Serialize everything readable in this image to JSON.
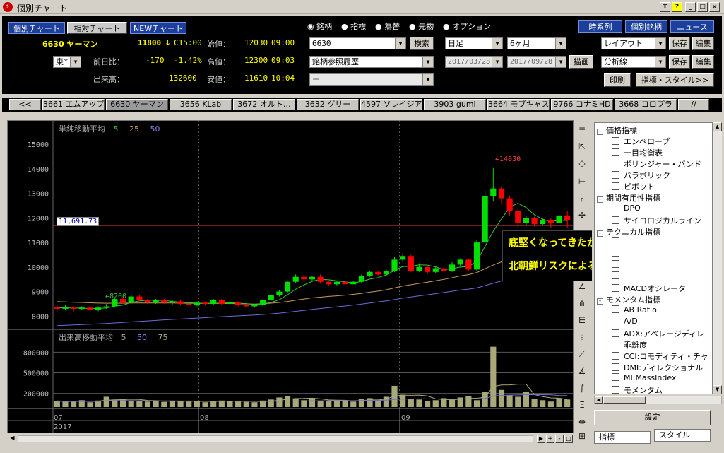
{
  "window": {
    "title": "個別チャート",
    "buttons": [
      "T",
      "?",
      "_",
      "□",
      "×"
    ]
  },
  "view_tabs": [
    "個別チャート",
    "相対チャート",
    "NEWチャート"
  ],
  "right_nav": [
    "時系列",
    "個別銘柄",
    "ニュース"
  ],
  "quote": {
    "code_name": "6630 ヤーマン",
    "price": "11800",
    "arrow": "↓",
    "time": "C15:00",
    "exchange": "東*",
    "change_label": "前日比：",
    "change": "-170",
    "change_pct": "-1.42%",
    "volume_label": "出来高：",
    "volume": "132600",
    "open_label": "始値：",
    "open": "12030",
    "open_time": "09:00",
    "high_label": "高値：",
    "high": "12300",
    "high_time": "09:03",
    "low_label": "安値：",
    "low": "11610",
    "low_time": "10:04"
  },
  "radios": {
    "items": [
      "銘柄",
      "指標",
      "為替",
      "先物",
      "オプション"
    ],
    "selected": "銘柄"
  },
  "symbol_input": "6630",
  "search_button": "検索",
  "history_select": "銘柄参照履歴",
  "blank_select": "ー",
  "period": {
    "interval": "日足",
    "span": "6ヶ月",
    "from": "2017/03/28",
    "to": "2017/09/28",
    "draw_button": "描画"
  },
  "layout": {
    "layout_label": "レイアウト",
    "analysis_label": "分析線",
    "save": "保存",
    "edit": "編集",
    "print": "印刷",
    "style_button": "指標・スタイル>>"
  },
  "stock_tabs": {
    "prev": "<<",
    "items": [
      "3661 エムアップ",
      "6630 ヤーマン",
      "3656 KLab",
      "3672 オルト…",
      "3632 グリー",
      "4597 ソレイジア",
      "3903 gumi",
      "3664 モブキャス",
      "9766 コナミHD",
      "3668 コロプラ"
    ],
    "active": "6630 ヤーマン",
    "next": "//"
  },
  "main_legend": {
    "title": "単純移動平均",
    "periods": [
      "5",
      "25",
      "50"
    ]
  },
  "vol_legend": {
    "title": "出来高移動平均",
    "periods": [
      "5",
      "50",
      "75"
    ]
  },
  "cursor_price": "11,691.73",
  "hi_label": "←14030",
  "lo_label": "←8200",
  "x_months": [
    "07",
    "08",
    "09"
  ],
  "x_year": "2017",
  "callout": {
    "line1": "底堅くなってきたか？",
    "line2": "北朝鮮リスクによる底抜けだけ危惧"
  },
  "tree": [
    {
      "type": "group",
      "label": "価格指標"
    },
    {
      "type": "item",
      "label": "エンベローブ"
    },
    {
      "type": "item",
      "label": "一目均衡表"
    },
    {
      "type": "item",
      "label": "ボリンジャー・バンド"
    },
    {
      "type": "item",
      "label": "パラボリック"
    },
    {
      "type": "item",
      "label": "ピボット"
    },
    {
      "type": "group",
      "label": "期間有用性指標"
    },
    {
      "type": "item",
      "label": "DPO"
    },
    {
      "type": "item",
      "label": "サイコロジカルライン"
    },
    {
      "type": "group",
      "label": "テクニカル指標"
    },
    {
      "type": "item",
      "label": ""
    },
    {
      "type": "item",
      "label": ""
    },
    {
      "type": "item",
      "label": ""
    },
    {
      "type": "item",
      "label": ""
    },
    {
      "type": "item",
      "label": "MACDオシレータ"
    },
    {
      "type": "group",
      "label": "モメンタム指標"
    },
    {
      "type": "item",
      "label": "AB Ratio"
    },
    {
      "type": "item",
      "label": "A/D"
    },
    {
      "type": "item",
      "label": "ADX:アベレージディレ"
    },
    {
      "type": "item",
      "label": "乖離度"
    },
    {
      "type": "item",
      "label": "CCI:コモディティ・チャ"
    },
    {
      "type": "item",
      "label": "DMI:ディレクショナル"
    },
    {
      "type": "item",
      "label": "MI:MassIndex"
    },
    {
      "type": "item",
      "label": "モメンタム"
    }
  ],
  "settings_button": "設定",
  "bottom_tabs": [
    "指標",
    "スタイル"
  ],
  "colors": {
    "up": "#00e000",
    "down": "#ff0000",
    "ma5": "#3cc43c",
    "ma25": "#c89a5a",
    "ma50": "#6a6ad8",
    "volume_bar": "#a8a878",
    "callout_text": "#ffff00"
  },
  "chart_data": {
    "type": "candlestick",
    "yticks": [
      8000,
      9000,
      10000,
      11000,
      12000,
      13000,
      14000,
      15000
    ],
    "vol_yticks": [
      200000,
      500000,
      800000
    ],
    "candles": [
      {
        "o": 8350,
        "c": 8300,
        "h": 8450,
        "l": 8200
      },
      {
        "o": 8300,
        "c": 8350,
        "h": 8450,
        "l": 8250
      },
      {
        "o": 8350,
        "c": 8300,
        "h": 8400,
        "l": 8200
      },
      {
        "o": 8300,
        "c": 8350,
        "h": 8400,
        "l": 8250
      },
      {
        "o": 8350,
        "c": 8250,
        "h": 8450,
        "l": 8200
      },
      {
        "o": 8250,
        "c": 8350,
        "h": 8400,
        "l": 8200
      },
      {
        "o": 8350,
        "c": 8400,
        "h": 8500,
        "l": 8300
      },
      {
        "o": 8400,
        "c": 8700,
        "h": 8750,
        "l": 8350
      },
      {
        "o": 8700,
        "c": 8550,
        "h": 8800,
        "l": 8500
      },
      {
        "o": 8550,
        "c": 8800,
        "h": 8900,
        "l": 8500
      },
      {
        "o": 8800,
        "c": 8650,
        "h": 8850,
        "l": 8600
      },
      {
        "o": 8650,
        "c": 8550,
        "h": 8700,
        "l": 8500
      },
      {
        "o": 8550,
        "c": 8650,
        "h": 8700,
        "l": 8500
      },
      {
        "o": 8650,
        "c": 8550,
        "h": 8700,
        "l": 8500
      },
      {
        "o": 8550,
        "c": 8600,
        "h": 8650,
        "l": 8450
      },
      {
        "o": 8600,
        "c": 8500,
        "h": 8650,
        "l": 8450
      },
      {
        "o": 8500,
        "c": 8450,
        "h": 8550,
        "l": 8400
      },
      {
        "o": 8450,
        "c": 8550,
        "h": 8600,
        "l": 8400
      },
      {
        "o": 8550,
        "c": 8500,
        "h": 8600,
        "l": 8450
      },
      {
        "o": 8500,
        "c": 8650,
        "h": 8700,
        "l": 8450
      },
      {
        "o": 8650,
        "c": 8500,
        "h": 8700,
        "l": 8450
      },
      {
        "o": 8500,
        "c": 8550,
        "h": 8600,
        "l": 8450
      },
      {
        "o": 8550,
        "c": 8450,
        "h": 8600,
        "l": 8400
      },
      {
        "o": 8450,
        "c": 8400,
        "h": 8500,
        "l": 8350
      },
      {
        "o": 8400,
        "c": 8450,
        "h": 8500,
        "l": 8350
      },
      {
        "o": 8450,
        "c": 8650,
        "h": 8700,
        "l": 8400
      },
      {
        "o": 8650,
        "c": 8850,
        "h": 8900,
        "l": 8600
      },
      {
        "o": 8850,
        "c": 9000,
        "h": 9050,
        "l": 8800
      },
      {
        "o": 9000,
        "c": 9400,
        "h": 9450,
        "l": 8950
      },
      {
        "o": 9400,
        "c": 9600,
        "h": 9700,
        "l": 9350
      },
      {
        "o": 9600,
        "c": 9500,
        "h": 9700,
        "l": 9400
      },
      {
        "o": 9500,
        "c": 9600,
        "h": 9650,
        "l": 9450
      },
      {
        "o": 9600,
        "c": 9400,
        "h": 9700,
        "l": 9350
      },
      {
        "o": 9400,
        "c": 9300,
        "h": 9450,
        "l": 9250
      },
      {
        "o": 9300,
        "c": 9400,
        "h": 9450,
        "l": 9250
      },
      {
        "o": 9400,
        "c": 9300,
        "h": 9450,
        "l": 9250
      },
      {
        "o": 9300,
        "c": 9400,
        "h": 9450,
        "l": 9300
      },
      {
        "o": 9400,
        "c": 9650,
        "h": 9700,
        "l": 9350
      },
      {
        "o": 9650,
        "c": 9800,
        "h": 9850,
        "l": 9600
      },
      {
        "o": 9800,
        "c": 9700,
        "h": 9850,
        "l": 9650
      },
      {
        "o": 9700,
        "c": 9850,
        "h": 9900,
        "l": 9650
      },
      {
        "o": 9850,
        "c": 10300,
        "h": 10400,
        "l": 9800
      },
      {
        "o": 10300,
        "c": 10450,
        "h": 10550,
        "l": 10200
      },
      {
        "o": 10450,
        "c": 9850,
        "h": 10500,
        "l": 9800
      },
      {
        "o": 9850,
        "c": 10000,
        "h": 10150,
        "l": 9800
      },
      {
        "o": 10000,
        "c": 9800,
        "h": 10050,
        "l": 9700
      },
      {
        "o": 9800,
        "c": 9950,
        "h": 10000,
        "l": 9750
      },
      {
        "o": 9950,
        "c": 9850,
        "h": 10000,
        "l": 9750
      },
      {
        "o": 9850,
        "c": 10100,
        "h": 10200,
        "l": 9800
      },
      {
        "o": 10100,
        "c": 10300,
        "h": 10350,
        "l": 10050
      },
      {
        "o": 10300,
        "c": 9900,
        "h": 10350,
        "l": 9850
      },
      {
        "o": 9900,
        "c": 11000,
        "h": 11100,
        "l": 9850
      },
      {
        "o": 11000,
        "c": 12900,
        "h": 13100,
        "l": 11000
      },
      {
        "o": 12900,
        "c": 13200,
        "h": 14030,
        "l": 12700
      },
      {
        "o": 13200,
        "c": 12800,
        "h": 13300,
        "l": 12600
      },
      {
        "o": 12800,
        "c": 12300,
        "h": 12900,
        "l": 12100
      },
      {
        "o": 12300,
        "c": 11800,
        "h": 12400,
        "l": 11600
      },
      {
        "o": 11800,
        "c": 12000,
        "h": 12100,
        "l": 11700
      },
      {
        "o": 12000,
        "c": 11750,
        "h": 12050,
        "l": 11650
      },
      {
        "o": 11750,
        "c": 11900,
        "h": 12000,
        "l": 11700
      },
      {
        "o": 11900,
        "c": 11800,
        "h": 12000,
        "l": 11600
      },
      {
        "o": 11800,
        "c": 12100,
        "h": 12300,
        "l": 11700
      },
      {
        "o": 12100,
        "c": 11900,
        "h": 12300,
        "l": 11610
      }
    ],
    "volumes": [
      90000,
      80000,
      85000,
      100000,
      70000,
      95000,
      150000,
      110000,
      120000,
      90000,
      85000,
      80000,
      95000,
      75000,
      90000,
      85000,
      80000,
      90000,
      70000,
      85000,
      95000,
      90000,
      80000,
      75000,
      70000,
      95000,
      110000,
      140000,
      160000,
      120000,
      100000,
      130000,
      90000,
      85000,
      100000,
      90000,
      80000,
      120000,
      130000,
      100000,
      150000,
      310000,
      180000,
      120000,
      110000,
      90000,
      100000,
      130000,
      110000,
      140000,
      160000,
      100000,
      220000,
      880000,
      250000,
      170000,
      150000,
      220000,
      120000,
      100000,
      80000,
      130000,
      110000
    ]
  }
}
